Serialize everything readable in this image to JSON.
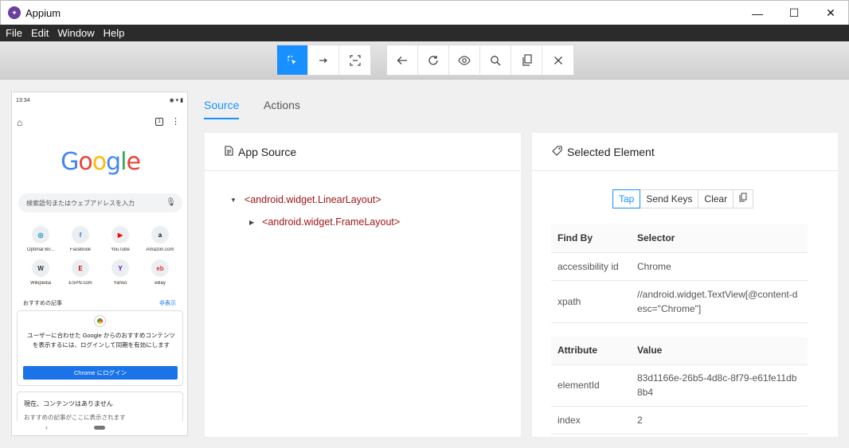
{
  "window": {
    "title": "Appium",
    "minimize": "—",
    "maximize": "☐",
    "close": "✕"
  },
  "menu": [
    "File",
    "Edit",
    "Window",
    "Help"
  ],
  "toolbar": {
    "group1": [
      {
        "icon": "select-element-icon",
        "glyph": "⬚"
      },
      {
        "icon": "swipe-icon",
        "glyph": "→"
      },
      {
        "icon": "tap-coordinates-icon",
        "glyph": "⛶"
      }
    ],
    "group2": [
      {
        "icon": "back-icon",
        "glyph": "←"
      },
      {
        "icon": "refresh-icon",
        "glyph": "↻"
      },
      {
        "icon": "eye-icon",
        "glyph": "◉"
      },
      {
        "icon": "search-icon",
        "glyph": "⌕"
      },
      {
        "icon": "copy-icon",
        "glyph": "❐"
      },
      {
        "icon": "close-icon",
        "glyph": "✕"
      }
    ]
  },
  "device": {
    "time": "13:34",
    "status_icons": "◉ ▾ ▮",
    "google": "Google",
    "search_placeholder": "検索語句またはウェブアドレスを入力",
    "shortcuts": [
      {
        "label": "Optimal Bir...",
        "badge": "◎",
        "color": "#0b8ec4"
      },
      {
        "label": "Facebook",
        "badge": "f",
        "color": "#1877f2"
      },
      {
        "label": "YouTube",
        "badge": "▶",
        "color": "#ff0000"
      },
      {
        "label": "Amazon.com",
        "badge": "a",
        "color": "#111111"
      },
      {
        "label": "Wikipedia",
        "badge": "W",
        "color": "#333333"
      },
      {
        "label": "ESPN.com",
        "badge": "E",
        "color": "#d00000"
      },
      {
        "label": "Yahoo",
        "badge": "Y",
        "color": "#6001d2"
      },
      {
        "label": "eBay",
        "badge": "eb",
        "color": "#e53238"
      }
    ],
    "articles_label": "おすすめの記事",
    "hide_label": "非表示",
    "card_text": "ユーザーに合わせた Google からのおすすめコンテンツを表示するには、ログインして同期を有効にします",
    "card_button": "Chrome にログイン",
    "no_content": "現在、コンテンツはありません",
    "no_content_sub": "おすすめの記事がここに表示されます"
  },
  "tabs": {
    "source": "Source",
    "actions": "Actions"
  },
  "app_source": {
    "title": "App Source",
    "nodes": [
      "<android.widget.LinearLayout>",
      "<android.widget.FrameLayout>"
    ]
  },
  "selected_element": {
    "title": "Selected Element",
    "actions": [
      "Tap",
      "Send Keys",
      "Clear"
    ],
    "find_by_header": "Find By",
    "selector_header": "Selector",
    "find_by": [
      {
        "key": "accessibility id",
        "value": "Chrome"
      },
      {
        "key": "xpath",
        "value": "//android.widget.TextView[@content-desc=\"Chrome\"]"
      }
    ],
    "attribute_header": "Attribute",
    "value_header": "Value",
    "attributes": [
      {
        "key": "elementId",
        "value": "83d1166e-26b5-4d8c-8f79-e61fe11db8b4"
      },
      {
        "key": "index",
        "value": "2"
      }
    ]
  }
}
